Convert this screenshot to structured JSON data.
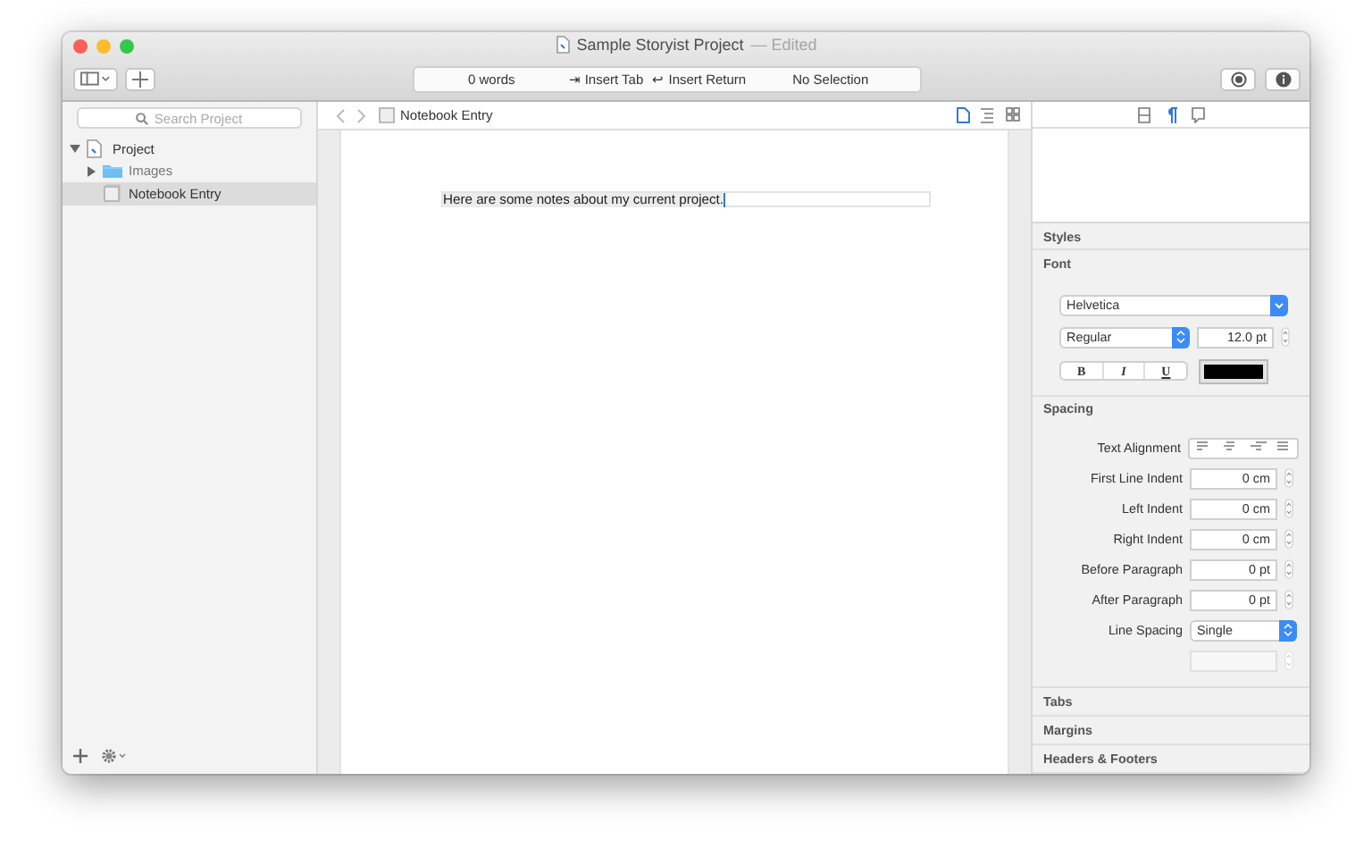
{
  "window": {
    "title": "Sample Storyist Project",
    "edited": "— Edited"
  },
  "toolbar": {
    "status": [
      "0 words",
      "⇥ Insert Tab",
      "↩ Insert Return",
      "No Selection"
    ]
  },
  "sidebar": {
    "search": {
      "placeholder": "Search Project"
    },
    "tree": [
      {
        "label": "Project",
        "kind": "project",
        "expanded": true,
        "selected": false,
        "children": [
          {
            "label": "Images",
            "kind": "folder",
            "expanded": false,
            "selected": false
          },
          {
            "label": "Notebook Entry",
            "kind": "note",
            "selected": true
          }
        ]
      }
    ]
  },
  "editor": {
    "breadcrumb": "Notebook Entry",
    "text": "Here are some notes about my current project.",
    "view_modes": [
      {
        "kind": "page",
        "selected": true
      },
      {
        "kind": "outline",
        "selected": false
      },
      {
        "kind": "grid",
        "selected": false
      }
    ]
  },
  "inspector": {
    "tabs": [
      {
        "kind": "layout",
        "selected": false
      },
      {
        "kind": "paragraph",
        "selected": true
      },
      {
        "kind": "comment",
        "selected": false
      }
    ],
    "styles_title": "Styles",
    "font": {
      "title": "Font",
      "family": "Helvetica",
      "typeface": "Regular",
      "size": "12.0 pt",
      "style_buttons": [
        {
          "label": "B",
          "kind": "bold",
          "selected": false
        },
        {
          "label": "I",
          "kind": "italic",
          "selected": false
        },
        {
          "label": "U",
          "kind": "underline",
          "selected": false
        }
      ]
    },
    "spacing": {
      "title": "Spacing",
      "alignment_label": "Text Alignment",
      "fields": [
        {
          "label": "First Line Indent",
          "value": "0 cm",
          "kind": "stepper"
        },
        {
          "label": "Left Indent",
          "value": "0 cm",
          "kind": "stepper"
        },
        {
          "label": "Right Indent",
          "value": "0 cm",
          "kind": "stepper"
        },
        {
          "label": "Before Paragraph",
          "value": "0 pt",
          "kind": "stepper"
        },
        {
          "label": "After Paragraph",
          "value": "0 pt",
          "kind": "stepper"
        },
        {
          "label": "Line Spacing",
          "value": "Single",
          "kind": "popup"
        },
        {
          "kind": "stepper",
          "disabled": true
        }
      ]
    },
    "collapsed_sections": [
      "Tabs",
      "Margins",
      "Headers & Footers"
    ]
  }
}
